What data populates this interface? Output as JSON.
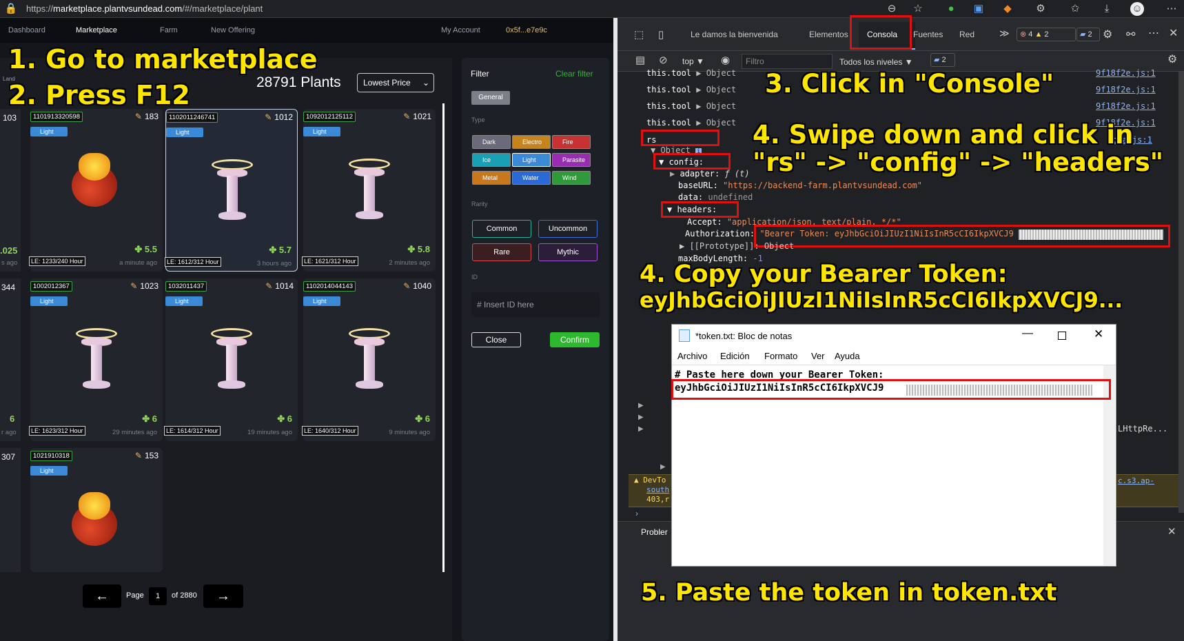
{
  "browser": {
    "url_prefix": "https://",
    "url_host": "marketplace.plantvsundead.com",
    "url_path": "/#/marketplace/plant"
  },
  "app": {
    "nav": [
      "Dashboard",
      "Marketplace",
      "Farm",
      "New Offering",
      "My Account",
      "0x5f...e7e9c"
    ],
    "land_label": "Land",
    "plants_count": "28791 Plants",
    "sort": "Lowest Price",
    "cards": [
      {
        "id": "1101913320598",
        "level": "183",
        "element": "Light",
        "le": "LE: 1233/240 Hour",
        "clover": "5.5",
        "ago": "a minute ago"
      },
      {
        "id": "1102011246741",
        "level": "1012",
        "element": "Light",
        "le": "LE: 1612/312 Hour",
        "clover": "5.7",
        "ago": "3 hours ago"
      },
      {
        "id": "1092012125112",
        "level": "1021",
        "element": "Light",
        "le": "LE: 1621/312 Hour",
        "clover": "5.8",
        "ago": "2 minutes ago"
      },
      {
        "id": "1002012367",
        "level": "1023",
        "element": "Light",
        "le": "LE: 1623/312 Hour",
        "clover": "6",
        "ago": "29 minutes ago"
      },
      {
        "id": "1032011437",
        "level": "1014",
        "element": "Light",
        "le": "LE: 1614/312 Hour",
        "clover": "6",
        "ago": "19 minutes ago"
      },
      {
        "id": "1102014044143",
        "level": "1040",
        "element": "Light",
        "le": "LE: 1640/312 Hour",
        "clover": "6",
        "ago": "9 minutes ago"
      },
      {
        "id": "1021910318",
        "level": "153",
        "element": "Light"
      }
    ],
    "partial": {
      "row1": [
        "103",
        ".025",
        "s ago"
      ],
      "row2": [
        "344",
        "6",
        "r ago"
      ],
      "row3": [
        "307"
      ]
    },
    "pagination": {
      "page_label": "Page",
      "page": "1",
      "of": "of 2880"
    },
    "filter": {
      "title": "Filter",
      "clear": "Clear filter",
      "general": "General",
      "type_label": "Type",
      "types": [
        "Dark",
        "Electro",
        "Fire",
        "Ice",
        "Light",
        "Parasite",
        "Metal",
        "Water",
        "Wind"
      ],
      "rarity_label": "Rarity",
      "rarities": [
        "Common",
        "Uncommon",
        "Rare",
        "Mythic"
      ],
      "id_label": "ID",
      "id_placeholder": "# Insert ID here",
      "close": "Close",
      "confirm": "Confirm"
    }
  },
  "devtools": {
    "tabs": [
      "Le damos la bienvenida",
      "Elementos",
      "Consola",
      "Fuentes",
      "Red"
    ],
    "errors": "4",
    "warnings": "2",
    "messages": "2",
    "context": "top",
    "filter_placeholder": "Filtro",
    "levels": "Todos los niveles",
    "levels_count": "2",
    "lines": [
      {
        "text": "this.tool",
        "obj": "Object",
        "link": "9f18f2e.js:1"
      },
      {
        "text": "this.tool",
        "obj": "Object",
        "link": "9f18f2e.js:1"
      },
      {
        "text": "this.tool",
        "obj": "Object",
        "link": "9f18f2e.js:1"
      },
      {
        "text": "this.tool",
        "obj": "Object",
        "link": "9f18f2e.js:1"
      }
    ],
    "extra_link": "c0a.js:1",
    "rs": "rs",
    "object_label": "Object",
    "config": "config:",
    "adapter_key": "adapter:",
    "adapter_val": "ƒ (t)",
    "baseurl_key": "baseURL:",
    "baseurl_val": "\"https://backend-farm.plantvsundead.com\"",
    "data_key": "data:",
    "data_val": "undefined",
    "headers": "headers:",
    "accept_key": "Accept:",
    "accept_val": "\"application/json, text/plain, */*\"",
    "auth_key": "Authorization:",
    "auth_val": "\"Bearer Token: eyJhbGciOiJIUzI1NiIsInR5cCI6IkpXVCJ9",
    "proto": "▶ [[Prototype]]: Object",
    "maxbody_key": "maxBodyLength:",
    "maxbody_val": "-1",
    "lhttp": "LHttpRe...",
    "warn_text": "DevTo",
    "warn_text2": "south",
    "warn_text3": "403,r",
    "warn_link": "c.s3.ap-",
    "bottom_tab": "Probler"
  },
  "notepad": {
    "title": "*token.txt: Bloc de notas",
    "menu": [
      "Archivo",
      "Edición",
      "Formato",
      "Ver",
      "Ayuda"
    ],
    "line1": "# Paste here down your Bearer Token:",
    "line2": "eyJhbGciOiJIUzI1NiIsInR5cCI6IkpXVCJ9"
  },
  "annotations": {
    "step1": "1. Go to marketplace",
    "step2": "2. Press F12",
    "step3": "3. Click in \"Console\"",
    "step4a": "4. Swipe down and click in",
    "step4b": "\"rs\" -> \"config\" -> \"headers\"",
    "step4c": "4. Copy your Bearer Token:",
    "step4d": "eyJhbGciOiJIUzI1NiIsInR5cCI6IkpXVCJ9...",
    "step5": "5. Paste the token in token.txt"
  },
  "colors": {
    "annotation": "#ffe600",
    "highlight": "#e01010",
    "confirm": "#2eb82e"
  }
}
